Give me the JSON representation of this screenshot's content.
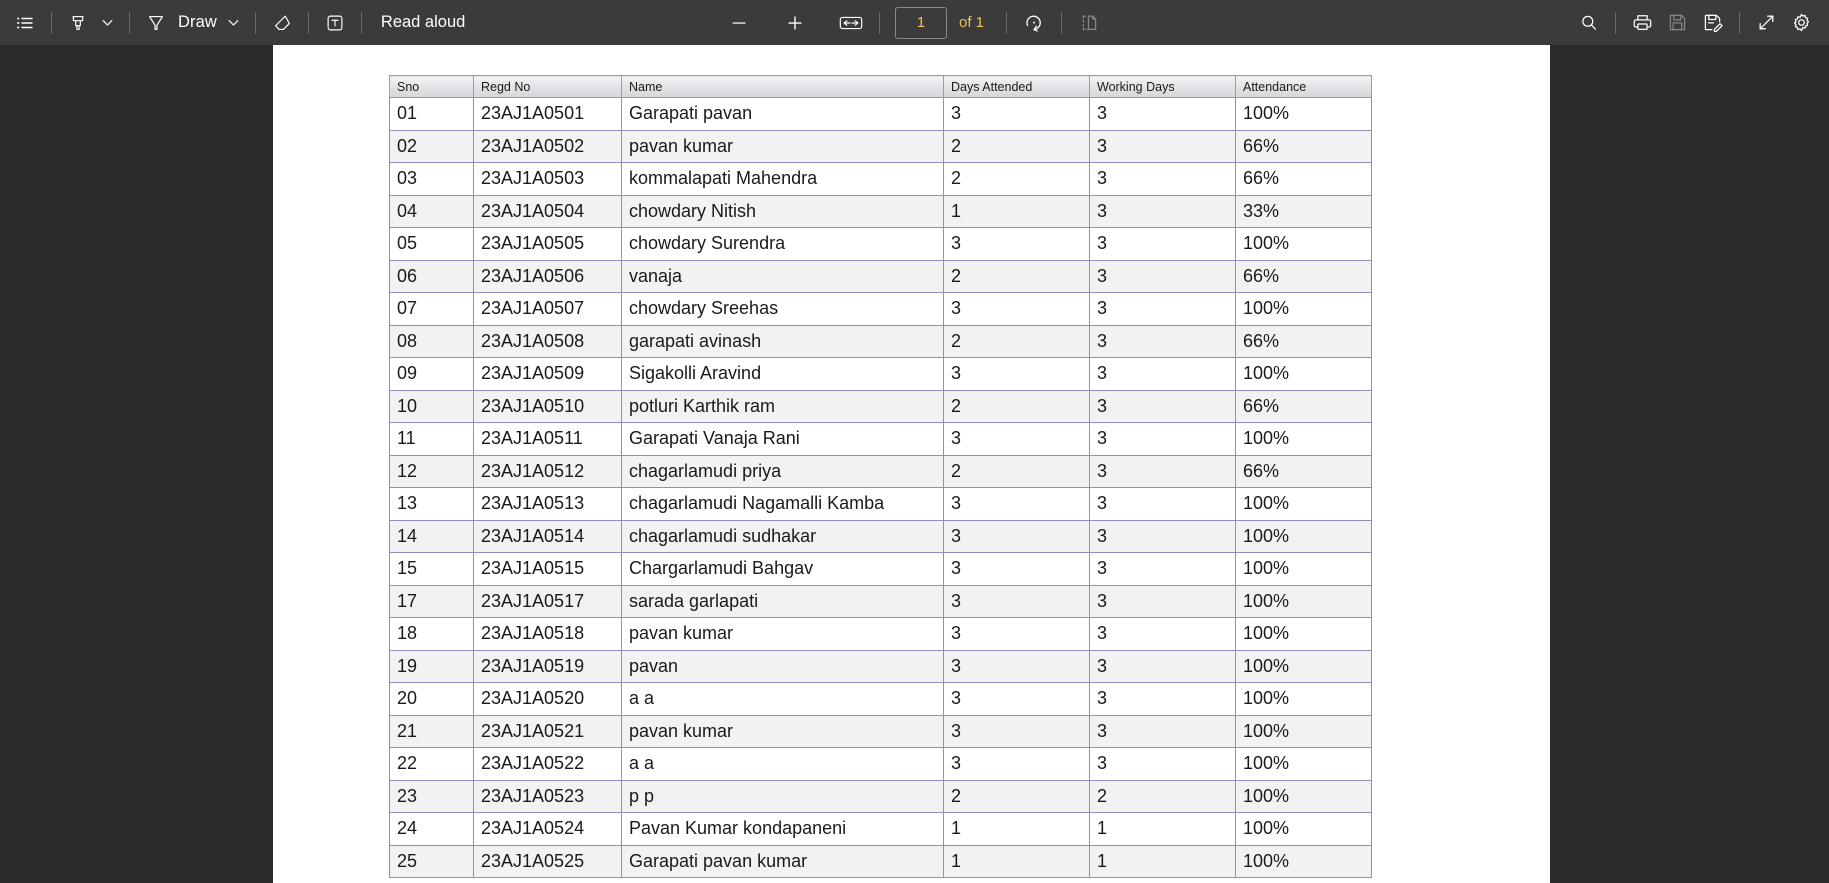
{
  "toolbar": {
    "left_items": [
      {
        "name": "list-view-icon",
        "icon": "list",
        "label": ""
      },
      {
        "name": "highlighter-icon",
        "icon": "highlighter",
        "label": ""
      },
      {
        "name": "highlighter-dropdown-icon",
        "icon": "chevron-down",
        "label": ""
      },
      {
        "name": "pen-draw-icon",
        "icon": "pen",
        "label": "Draw"
      },
      {
        "name": "draw-dropdown-icon",
        "icon": "chevron-down",
        "label": ""
      },
      {
        "name": "eraser-icon",
        "icon": "eraser",
        "label": ""
      },
      {
        "name": "text-tool-icon",
        "icon": "text-box",
        "label": ""
      }
    ],
    "draw_label": "Draw",
    "read_aloud_label": "Read aloud",
    "zoom_out_label": "−",
    "zoom_in_label": "+",
    "fit_page_label": "",
    "page_number": "1",
    "page_count_label": "of 1",
    "rotate_label": "",
    "page_layout_label": "",
    "right_items": [
      {
        "name": "search-icon",
        "icon": "search",
        "disabled": false
      },
      {
        "name": "print-icon",
        "icon": "print",
        "disabled": false
      },
      {
        "name": "save-icon",
        "icon": "save",
        "disabled": true
      },
      {
        "name": "save-as-icon",
        "icon": "save-edit",
        "disabled": false
      },
      {
        "name": "fullscreen-icon",
        "icon": "expand",
        "disabled": false
      },
      {
        "name": "settings-icon",
        "icon": "gear",
        "disabled": false
      }
    ],
    "accent_color": "#f2c14e",
    "background_color": "#3b3b3b"
  },
  "table": {
    "columns": [
      "Sno",
      "Regd No",
      "Name",
      "Days Attended",
      "Working Days",
      "Attendance"
    ],
    "rows": [
      {
        "sno": "01",
        "regd": "23AJ1A0501",
        "name": "Garapati pavan",
        "days": "3",
        "working": "3",
        "attendance": "100%"
      },
      {
        "sno": "02",
        "regd": "23AJ1A0502",
        "name": "pavan kumar",
        "days": "2",
        "working": "3",
        "attendance": "66%"
      },
      {
        "sno": "03",
        "regd": "23AJ1A0503",
        "name": "kommalapati Mahendra",
        "days": "2",
        "working": "3",
        "attendance": "66%"
      },
      {
        "sno": "04",
        "regd": "23AJ1A0504",
        "name": "chowdary Nitish",
        "days": "1",
        "working": "3",
        "attendance": "33%"
      },
      {
        "sno": "05",
        "regd": "23AJ1A0505",
        "name": "chowdary Surendra",
        "days": "3",
        "working": "3",
        "attendance": "100%"
      },
      {
        "sno": "06",
        "regd": "23AJ1A0506",
        "name": "vanaja",
        "days": "2",
        "working": "3",
        "attendance": "66%"
      },
      {
        "sno": "07",
        "regd": "23AJ1A0507",
        "name": "chowdary Sreehas",
        "days": "3",
        "working": "3",
        "attendance": "100%"
      },
      {
        "sno": "08",
        "regd": "23AJ1A0508",
        "name": "garapati  avinash",
        "days": "2",
        "working": "3",
        "attendance": "66%"
      },
      {
        "sno": "09",
        "regd": "23AJ1A0509",
        "name": "Sigakolli Aravind",
        "days": "3",
        "working": "3",
        "attendance": "100%"
      },
      {
        "sno": "10",
        "regd": "23AJ1A0510",
        "name": "potluri Karthik ram",
        "days": "2",
        "working": "3",
        "attendance": "66%"
      },
      {
        "sno": "11",
        "regd": "23AJ1A0511",
        "name": "Garapati Vanaja Rani",
        "days": "3",
        "working": "3",
        "attendance": "100%"
      },
      {
        "sno": "12",
        "regd": "23AJ1A0512",
        "name": "chagarlamudi priya",
        "days": "2",
        "working": "3",
        "attendance": "66%"
      },
      {
        "sno": "13",
        "regd": "23AJ1A0513",
        "name": "chagarlamudi Nagamalli Kamba",
        "days": "3",
        "working": "3",
        "attendance": "100%"
      },
      {
        "sno": "14",
        "regd": "23AJ1A0514",
        "name": "chagarlamudi sudhakar",
        "days": "3",
        "working": "3",
        "attendance": "100%"
      },
      {
        "sno": "15",
        "regd": "23AJ1A0515",
        "name": "Chargarlamudi Bahgav",
        "days": "3",
        "working": "3",
        "attendance": "100%"
      },
      {
        "sno": "17",
        "regd": "23AJ1A0517",
        "name": "sarada garlapati",
        "days": "3",
        "working": "3",
        "attendance": "100%"
      },
      {
        "sno": "18",
        "regd": "23AJ1A0518",
        "name": "pavan kumar",
        "days": "3",
        "working": "3",
        "attendance": "100%"
      },
      {
        "sno": "19",
        "regd": "23AJ1A0519",
        "name": "pavan",
        "days": "3",
        "working": "3",
        "attendance": "100%"
      },
      {
        "sno": "20",
        "regd": "23AJ1A0520",
        "name": "a a",
        "days": "3",
        "working": "3",
        "attendance": "100%"
      },
      {
        "sno": "21",
        "regd": "23AJ1A0521",
        "name": "pavan kumar",
        "days": "3",
        "working": "3",
        "attendance": "100%"
      },
      {
        "sno": "22",
        "regd": "23AJ1A0522",
        "name": "a a",
        "days": "3",
        "working": "3",
        "attendance": "100%"
      },
      {
        "sno": "23",
        "regd": "23AJ1A0523",
        "name": "p p",
        "days": "2",
        "working": "2",
        "attendance": "100%"
      },
      {
        "sno": "24",
        "regd": "23AJ1A0524",
        "name": "Pavan Kumar kondapaneni",
        "days": "1",
        "working": "1",
        "attendance": "100%"
      },
      {
        "sno": "25",
        "regd": "23AJ1A0525",
        "name": "Garapati pavan kumar",
        "days": "1",
        "working": "1",
        "attendance": "100%"
      }
    ]
  }
}
